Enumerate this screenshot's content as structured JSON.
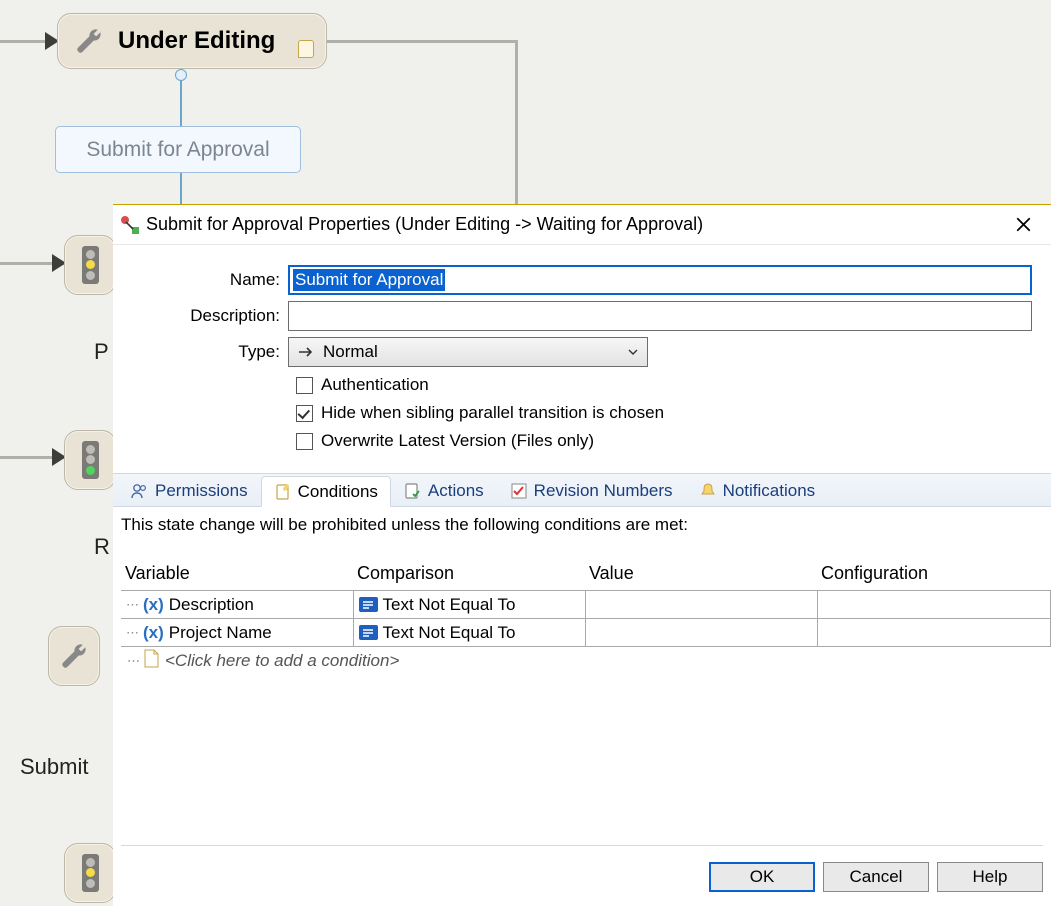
{
  "workflow": {
    "state_under_editing": "Under Editing",
    "transition_submit": "Submit for Approval",
    "labels": {
      "p": "P",
      "r": "R",
      "submit_partial": "Submit"
    }
  },
  "dialog": {
    "title": "Submit for Approval Properties (Under Editing -> Waiting for Approval)",
    "fields": {
      "name_label": "Name:",
      "name_value": "Submit for Approval",
      "description_label": "Description:",
      "description_value": "",
      "type_label": "Type:",
      "type_value": "Normal"
    },
    "checks": {
      "auth": {
        "label": "Authentication",
        "checked": false
      },
      "hide": {
        "label": "Hide when sibling parallel transition is chosen",
        "checked": true
      },
      "overwrite": {
        "label": "Overwrite Latest Version (Files only)",
        "checked": false
      }
    },
    "tabs": {
      "permissions": "Permissions",
      "conditions": "Conditions",
      "actions": "Actions",
      "revision": "Revision Numbers",
      "notifications": "Notifications"
    },
    "conditions": {
      "note": "This state change will be prohibited unless the following conditions are met:",
      "headers": {
        "variable": "Variable",
        "comparison": "Comparison",
        "value": "Value",
        "configuration": "Configuration"
      },
      "rows": [
        {
          "variable": "Description",
          "comparison": "Text Not Equal To",
          "value": "",
          "configuration": ""
        },
        {
          "variable": "Project Name",
          "comparison": "Text Not Equal To",
          "value": "",
          "configuration": ""
        }
      ],
      "add_placeholder": "<Click here to add a condition>"
    },
    "buttons": {
      "ok": "OK",
      "cancel": "Cancel",
      "help": "Help"
    }
  }
}
